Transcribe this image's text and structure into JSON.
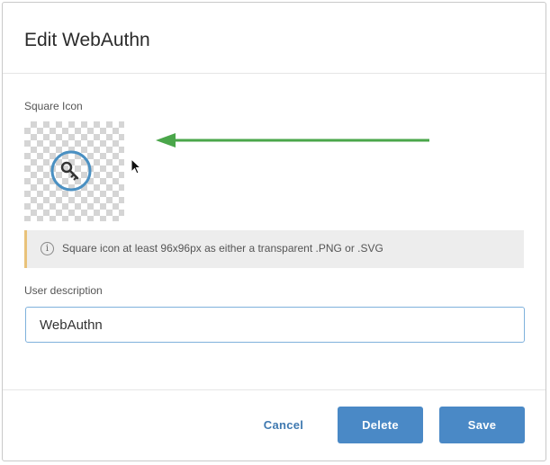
{
  "dialog": {
    "title": "Edit WebAuthn"
  },
  "square_icon": {
    "label": "Square Icon",
    "image_icon": "key-in-circle-icon"
  },
  "info_banner": {
    "icon": "info-icon",
    "icon_glyph": "i",
    "text": "Square icon at least 96x96px as either a transparent .PNG or .SVG"
  },
  "user_description": {
    "label": "User description",
    "value": "WebAuthn"
  },
  "buttons": {
    "cancel": "Cancel",
    "delete": "Delete",
    "save": "Save"
  },
  "colors": {
    "primary": "#4a89c6",
    "link": "#3f79b0",
    "banner_accent": "#e9c27a",
    "annotation_arrow": "#4aa64a"
  }
}
